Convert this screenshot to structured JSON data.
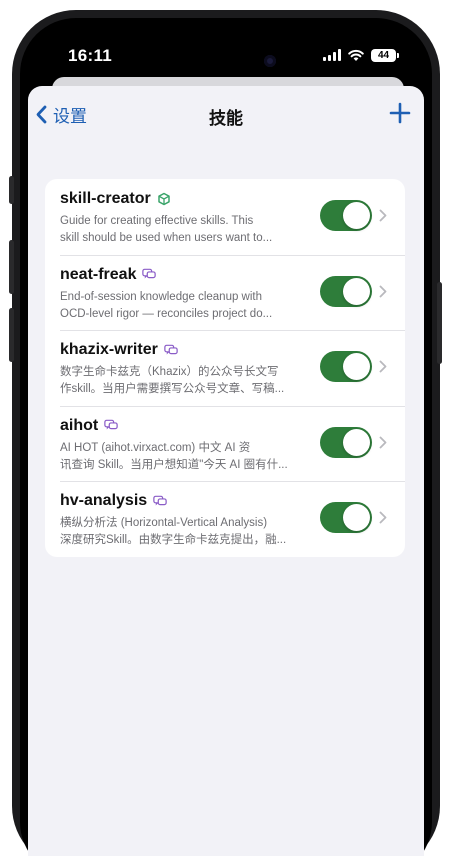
{
  "status_bar": {
    "time": "16:11",
    "battery_level": "44",
    "icons": [
      "signal-icon",
      "wifi-icon",
      "battery-icon"
    ]
  },
  "nav": {
    "back_label": "设置",
    "title": "技能",
    "add_icon": "plus-icon"
  },
  "colors": {
    "accent": "#1e5fb3",
    "toggle_on": "#2e7d3a",
    "background": "#f2f2f7",
    "badge_green": "#3aa46a",
    "badge_purple": "#8a5cc7"
  },
  "skills": [
    {
      "name": "skill-creator",
      "badge_icon": "cube-icon",
      "desc_line1": "Guide for creating effective skills. This",
      "desc_line2": "skill should be used when users want to...",
      "enabled": true
    },
    {
      "name": "neat-freak",
      "badge_icon": "chat-bubbles-icon",
      "desc_line1": "End-of-session knowledge cleanup with",
      "desc_line2": "OCD-level rigor — reconciles project do...",
      "enabled": true
    },
    {
      "name": "khazix-writer",
      "badge_icon": "chat-bubbles-icon",
      "desc_line1": "数字生命卡兹克（Khazix）的公众号长文写",
      "desc_line2": "作skill。当用户需要撰写公众号文章、写稿...",
      "enabled": true
    },
    {
      "name": "aihot",
      "badge_icon": "chat-bubbles-icon",
      "desc_line1": "AI HOT (aihot.virxact.com) 中文 AI 资",
      "desc_line2": "讯查询 Skill。当用户想知道\"今天 AI 圈有什...",
      "enabled": true
    },
    {
      "name": "hv-analysis",
      "badge_icon": "chat-bubbles-icon",
      "desc_line1": "横纵分析法 (Horizontal-Vertical Analysis)",
      "desc_line2": "深度研究Skill。由数字生命卡兹克提出，融...",
      "enabled": true
    }
  ]
}
